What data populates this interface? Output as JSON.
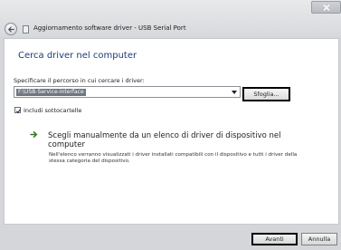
{
  "window": {
    "title": "Aggiornamento software driver - USB Serial Port"
  },
  "page": {
    "heading": "Cerca driver nel computer",
    "path_label": "Specificare il percorso in cui cercare i driver:",
    "path_value": "F:\\USB-Service-Interface",
    "browse_label": "Sfoglia...",
    "include_subfolders_label": "Includi sottocartelle",
    "include_subfolders_checked": true,
    "manual_option_title": "Scegli manualmente da un elenco di driver di dispositivo nel computer",
    "manual_option_description": "Nell'elenco verranno visualizzati i driver installati compatibili con il dispositivo e tutti i driver della stessa categoria del dispositivo."
  },
  "footer": {
    "next_label": "Avanti",
    "cancel_label": "Annulla"
  }
}
